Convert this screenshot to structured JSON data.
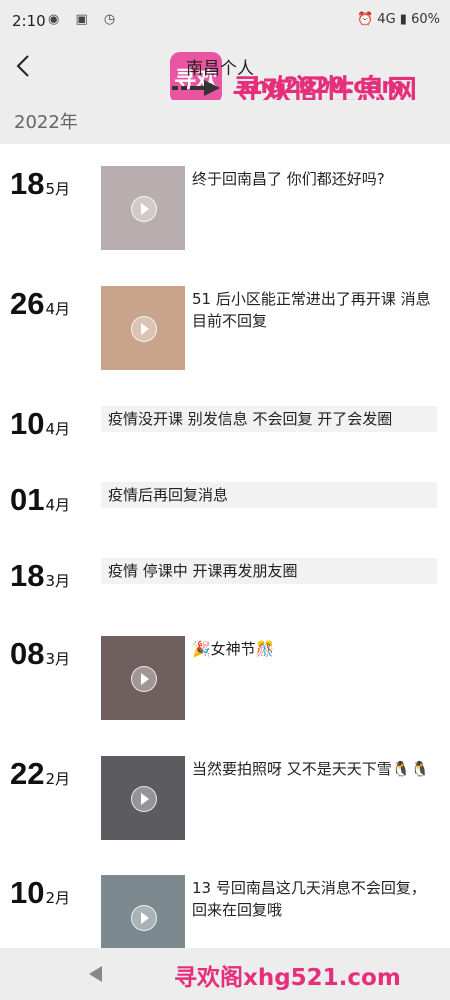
{
  "status_bar": {
    "time": "2:10",
    "battery": "60%",
    "network": "4G"
  },
  "header": {
    "title": "南昌个人"
  },
  "watermark": {
    "logo_text": "寻欢",
    "site_name": "寻欢阁性息网",
    "site_url": "xhg2020.com",
    "bottom_text": "寻欢阁xhg521.com"
  },
  "year": "2022年",
  "entries": [
    {
      "day": "18",
      "month": "5月",
      "type": "video",
      "caption": "终于回南昌了 你们都还好吗?"
    },
    {
      "day": "26",
      "month": "4月",
      "type": "video",
      "caption": "51 后小区能正常进出了再开课 消息目前不回复"
    },
    {
      "day": "10",
      "month": "4月",
      "type": "text",
      "caption": "疫情没开课 别发信息 不会回复 开了会发圈"
    },
    {
      "day": "01",
      "month": "4月",
      "type": "text",
      "caption": "疫情后再回复消息"
    },
    {
      "day": "18",
      "month": "3月",
      "type": "text",
      "caption": "疫情 停课中 开课再发朋友圈"
    },
    {
      "day": "08",
      "month": "3月",
      "type": "video",
      "caption": "🎉女神节🎊"
    },
    {
      "day": "22",
      "month": "2月",
      "type": "video",
      "caption": "当然要拍照呀 又不是天天下雪🐧🐧"
    },
    {
      "day": "10",
      "month": "2月",
      "type": "video",
      "caption": "13 号回南昌这几天消息不会回复，回来在回复哦"
    }
  ],
  "colors": {
    "header_bg": "#ededed",
    "text_box_bg": "#f2f2f2",
    "watermark": "#e52f7b"
  }
}
